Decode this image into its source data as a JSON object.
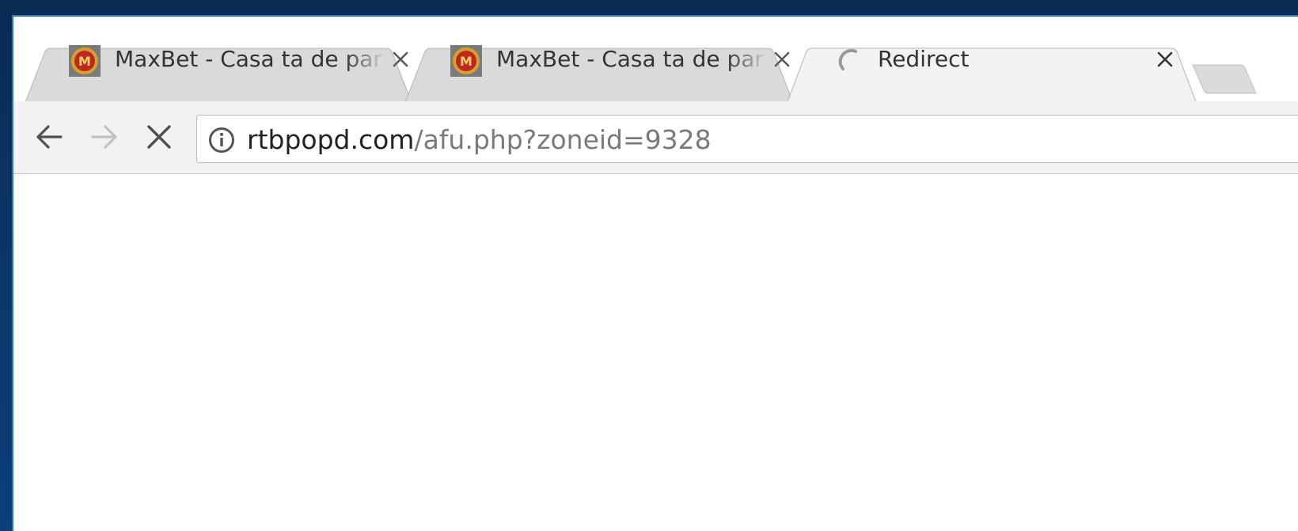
{
  "tabs": [
    {
      "title": "MaxBet - Casa ta de pariuri",
      "favicon": "maxbet-logo",
      "state": "inactive"
    },
    {
      "title": "MaxBet - Casa ta de pariuri",
      "favicon": "maxbet-logo",
      "state": "inactive"
    },
    {
      "title": "Redirect",
      "favicon": "loading-spinner-icon",
      "state": "active-loading"
    }
  ],
  "toolbar": {
    "back": "back-arrow-icon",
    "forward": "forward-arrow-icon",
    "stop": "stop-loading-icon"
  },
  "omnibox": {
    "security": "info-icon",
    "host": "rtbpopd.com",
    "path": "/afu.php?zoneid=9328"
  },
  "colors": {
    "desktop": "#0b3566",
    "window_border": "#2b74c7",
    "inactive_tab": "#dadada",
    "active_tab": "#f2f2f2",
    "toolbar": "#f2f2f2",
    "favicon_red": "#c0261c",
    "favicon_gold": "#d4a22a"
  }
}
